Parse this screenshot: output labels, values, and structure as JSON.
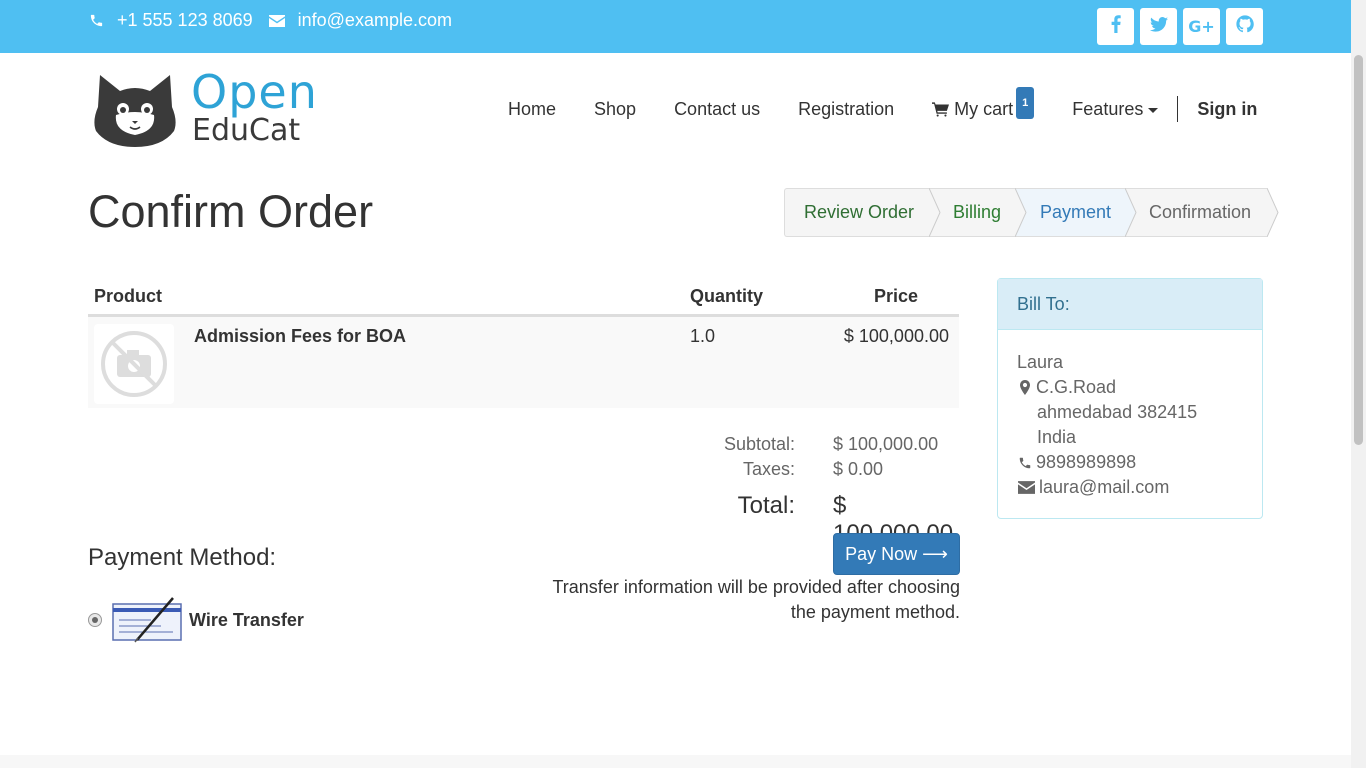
{
  "topbar": {
    "phone": "+1 555 123 8069",
    "email": "info@example.com",
    "social": [
      {
        "icon": "facebook-icon",
        "glyph": "f"
      },
      {
        "icon": "twitter-icon",
        "glyph": "t"
      },
      {
        "icon": "google-plus-icon",
        "glyph": "G+"
      },
      {
        "icon": "github-icon",
        "glyph": "gh"
      }
    ],
    "color": "#4fbff2"
  },
  "logo": {
    "line1": "Open",
    "line2": "EduCat"
  },
  "nav": {
    "home": "Home",
    "shop": "Shop",
    "contact": "Contact us",
    "registration": "Registration",
    "cart": "My cart",
    "cart_count": "1",
    "features": "Features",
    "signin": "Sign in"
  },
  "page": {
    "title": "Confirm Order"
  },
  "wizard": {
    "steps": [
      "Review Order",
      "Billing",
      "Payment",
      "Confirmation"
    ],
    "active": "Payment"
  },
  "order": {
    "headers": {
      "product": "Product",
      "quantity": "Quantity",
      "price": "Price"
    },
    "items": [
      {
        "name": "Admission Fees for BOA",
        "quantity": "1.0",
        "price": "$ 100,000.00"
      }
    ],
    "subtotal_label": "Subtotal:",
    "subtotal": "$ 100,000.00",
    "taxes_label": "Taxes:",
    "taxes": "$ 0.00",
    "total_label": "Total:",
    "total": "$ 100,000.00"
  },
  "payment": {
    "title": "Payment Method:",
    "method": "Wire Transfer",
    "pay_button": "Pay Now ⟶",
    "note": "Transfer information will be provided after choosing the payment method."
  },
  "billto": {
    "title": "Bill To:",
    "name": "Laura",
    "street": "C.G.Road",
    "city": "ahmedabad 382415",
    "country": "India",
    "phone": "9898989898",
    "email": "laura@mail.com"
  },
  "colors": {
    "primary": "#337ab7",
    "topbar": "#4fbff2",
    "brand": "#2ea3d6",
    "step_done": "#2e7d32"
  }
}
